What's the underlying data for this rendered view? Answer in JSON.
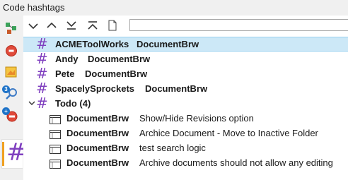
{
  "window": {
    "title": "Code hashtags"
  },
  "sidebar": {
    "badges": [
      "3",
      "+"
    ],
    "hashtag_tab": "#"
  },
  "toolbar": {
    "buttons": [
      "expand-icon",
      "collapse-icon",
      "expand-all-icon",
      "collapse-all-icon",
      "new-file-icon"
    ],
    "search_value": ""
  },
  "tree": {
    "hash_glyph": "#",
    "tags": [
      {
        "name": "ACMEToolWorks",
        "project": "DocumentBrw",
        "selected": true
      },
      {
        "name": "Andy",
        "project": "DocumentBrw",
        "selected": false
      },
      {
        "name": "Pete",
        "project": "DocumentBrw",
        "selected": false
      },
      {
        "name": "SpacelySprockets",
        "project": "DocumentBrw",
        "selected": false
      }
    ],
    "todo": {
      "label": "Todo (4)",
      "expanded": true,
      "items": [
        {
          "project": "DocumentBrw",
          "text": "Show/Hide Revisions option"
        },
        {
          "project": "DocumentBrw",
          "text": "Archice Document - Move to Inactive Folder"
        },
        {
          "project": "DocumentBrw",
          "text": "test search logic"
        },
        {
          "project": "DocumentBrw",
          "text": "Archive documents should not allow any editing"
        }
      ]
    }
  },
  "colors": {
    "hash": "#7f3fbf",
    "selection": "#cce8f7",
    "accent_bar": "#f0a020"
  }
}
